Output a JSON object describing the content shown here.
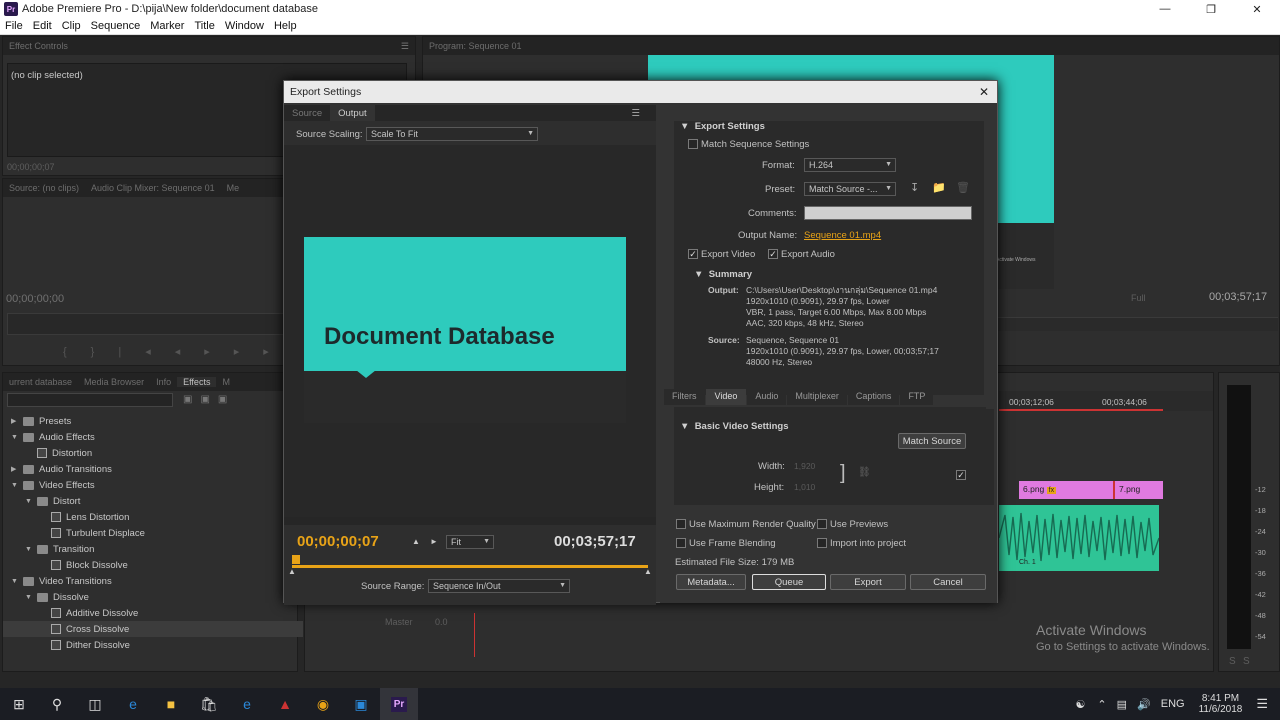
{
  "window": {
    "title": "Adobe Premiere Pro - D:\\pija\\New folder\\document database",
    "icon_label": "Pr"
  },
  "menu": [
    "File",
    "Edit",
    "Clip",
    "Sequence",
    "Marker",
    "Title",
    "Window",
    "Help"
  ],
  "left_top": {
    "tab": "Effect Controls",
    "no_clip": "(no clip selected)",
    "timecode": "00;00;00;07"
  },
  "source": {
    "tab1": "Source: (no clips)",
    "tab2": "Audio Clip Mixer: Sequence 01",
    "tab3": "Me",
    "timecode": "00;00;00;00"
  },
  "program": {
    "tab": "Program: Sequence 01",
    "fit": "Full",
    "timecode": "00;03;57;17",
    "mini_text": "Activate Windows"
  },
  "effects_panel": {
    "tabs": [
      "urrent database",
      "Media Browser",
      "Info",
      "Effects",
      "M"
    ],
    "items": [
      {
        "label": "Presets",
        "level": 0,
        "kind": "folder",
        "open": false
      },
      {
        "label": "Audio Effects",
        "level": 0,
        "kind": "folder",
        "open": true
      },
      {
        "label": "Distortion",
        "level": 1,
        "kind": "fx"
      },
      {
        "label": "Audio Transitions",
        "level": 0,
        "kind": "folder",
        "open": false
      },
      {
        "label": "Video Effects",
        "level": 0,
        "kind": "folder",
        "open": true
      },
      {
        "label": "Distort",
        "level": 1,
        "kind": "folder",
        "open": true
      },
      {
        "label": "Lens Distortion",
        "level": 2,
        "kind": "fx"
      },
      {
        "label": "Turbulent Displace",
        "level": 2,
        "kind": "fx"
      },
      {
        "label": "Transition",
        "level": 1,
        "kind": "folder",
        "open": true
      },
      {
        "label": "Block Dissolve",
        "level": 2,
        "kind": "fx"
      },
      {
        "label": "Video Transitions",
        "level": 0,
        "kind": "folder",
        "open": true
      },
      {
        "label": "Dissolve",
        "level": 1,
        "kind": "folder",
        "open": true
      },
      {
        "label": "Additive Dissolve",
        "level": 2,
        "kind": "fx"
      },
      {
        "label": "Cross Dissolve",
        "level": 2,
        "kind": "fx",
        "selected": true
      },
      {
        "label": "Dither Dissolve",
        "level": 2,
        "kind": "fx"
      }
    ]
  },
  "timeline": {
    "ruler": [
      "00;03;12;06",
      "00;03;44;06"
    ],
    "clip1": "6.png",
    "clip2": "7.png",
    "audio_label": "Ch. 1",
    "master": "Master",
    "master_val": "0.0",
    "meter_ticks": [
      "-12",
      "-18",
      "-24",
      "-30",
      "-36",
      "-42",
      "-48",
      "-54"
    ],
    "meter_bottom": [
      "S",
      "S"
    ]
  },
  "dialog": {
    "title": "Export Settings",
    "close": "✕",
    "tabs": [
      "Source",
      "Output"
    ],
    "source_scaling_label": "Source Scaling:",
    "source_scaling_value": "Scale To Fit",
    "preview_title": "Document Database",
    "current_time": "00;00;00;07",
    "fit": "Fit",
    "duration": "00;03;57;17",
    "source_range_label": "Source Range:",
    "source_range_value": "Sequence In/Out",
    "export_settings_header": "Export Settings",
    "match_sequence": "Match Sequence Settings",
    "format_label": "Format:",
    "format_value": "H.264",
    "preset_label": "Preset:",
    "preset_value": "Match Source -...",
    "comments_label": "Comments:",
    "output_name_label": "Output Name:",
    "output_name_value": "Sequence 01.mp4",
    "export_video": "Export Video",
    "export_audio": "Export Audio",
    "summary_header": "Summary",
    "output_label": "Output:",
    "output_lines": [
      "C:\\Users\\User\\Desktop\\งานกลุ่ม\\Sequence 01.mp4",
      "1920x1010 (0.9091), 29.97 fps, Lower",
      "VBR, 1 pass, Target 6.00 Mbps, Max 8.00 Mbps",
      "AAC, 320 kbps, 48 kHz, Stereo"
    ],
    "source_label": "Source:",
    "source_lines": [
      "Sequence, Sequence 01",
      "1920x1010 (0.9091), 29.97 fps, Lower, 00;03;57;17",
      "48000 Hz, Stereo"
    ],
    "subtabs": [
      "Filters",
      "Video",
      "Audio",
      "Multiplexer",
      "Captions",
      "FTP"
    ],
    "basic_video_header": "Basic Video Settings",
    "match_source_btn": "Match Source",
    "width_label": "Width:",
    "width_value": "1,920",
    "height_label": "Height:",
    "height_value": "1,010",
    "max_render": "Use Maximum Render Quality",
    "use_previews": "Use Previews",
    "frame_blending": "Use Frame Blending",
    "import_project": "Import into project",
    "file_size": "Estimated File Size:  179 MB",
    "btn_metadata": "Metadata...",
    "btn_queue": "Queue",
    "btn_export": "Export",
    "btn_cancel": "Cancel"
  },
  "watermark": {
    "line1": "Activate Windows",
    "line2": "Go to Settings to activate Windows."
  },
  "taskbar": {
    "lang": "ENG",
    "time": "8:41 PM",
    "date": "11/6/2018"
  },
  "colors": {
    "teal": "#2ecbbd",
    "orange": "#e8a317",
    "pink": "#e07ae0",
    "audio": "#2fc496"
  }
}
